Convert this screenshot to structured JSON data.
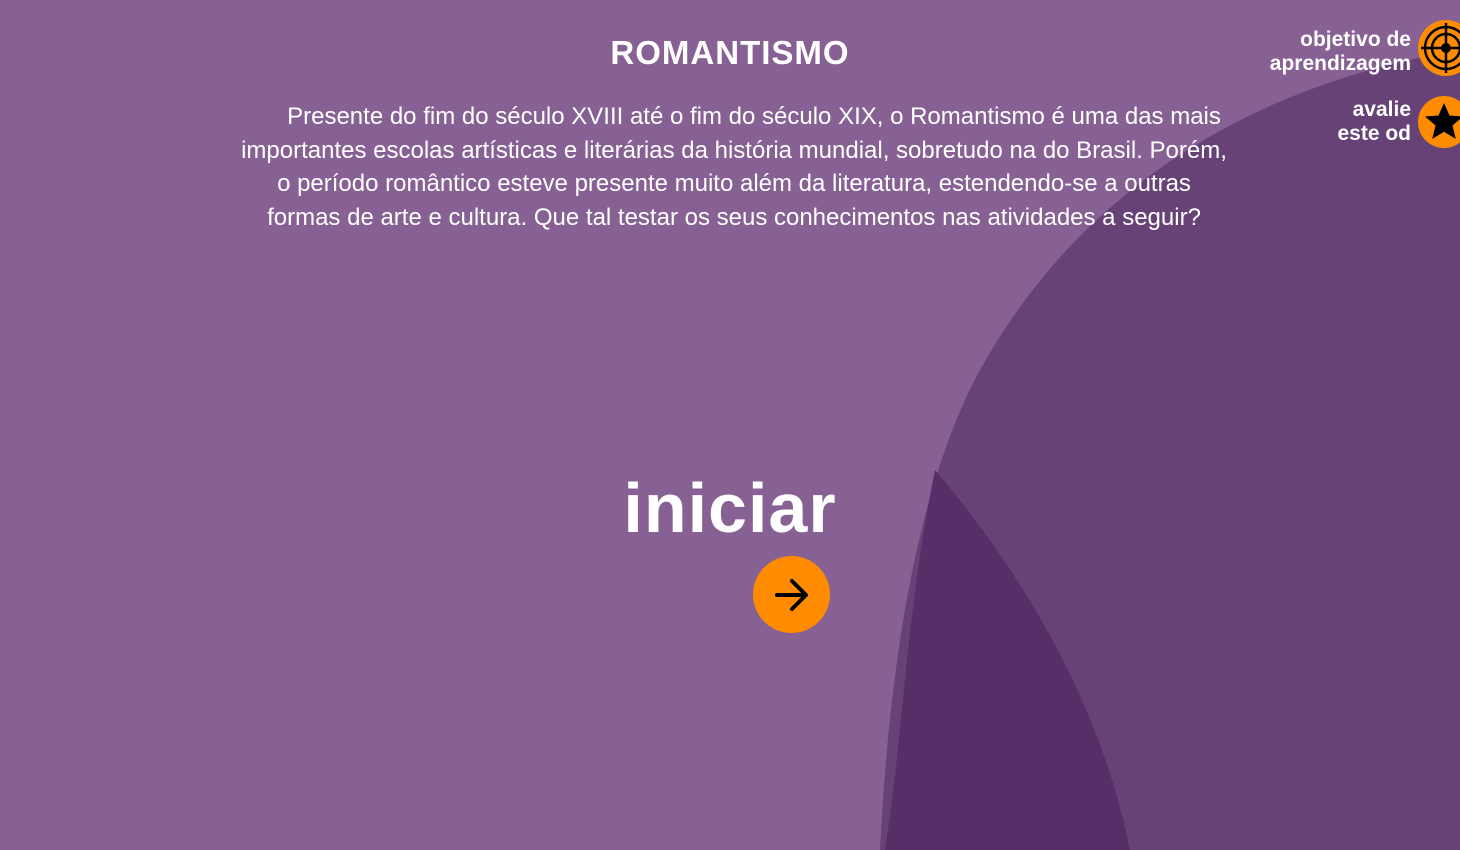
{
  "header": {
    "title": "ROMANTISMO"
  },
  "intro": {
    "text": "Presente do fim do século XVIII até o fim do século XIX, o Romantismo é uma das mais importantes escolas artísticas e literárias da história mundial, sobretudo na do Brasil. Porém, o período romântico esteve presente muito além da literatura, estendendo-se a outras formas de arte e cultura. Que tal testar os seus conhecimentos nas atividades a seguir?"
  },
  "start": {
    "label": "iniciar",
    "button_icon": "arrow-right-icon"
  },
  "side_menu": {
    "objetivo": {
      "line1": "objetivo de",
      "line2": "aprendizagem",
      "icon": "target-icon"
    },
    "avalie": {
      "line1": "avalie",
      "line2": "este od",
      "icon": "star-icon"
    }
  },
  "colors": {
    "background": "#876194",
    "shape_mid": "#674277",
    "shape_dark": "#572f68",
    "accent": "#ff8c00",
    "text": "#ffffff"
  }
}
